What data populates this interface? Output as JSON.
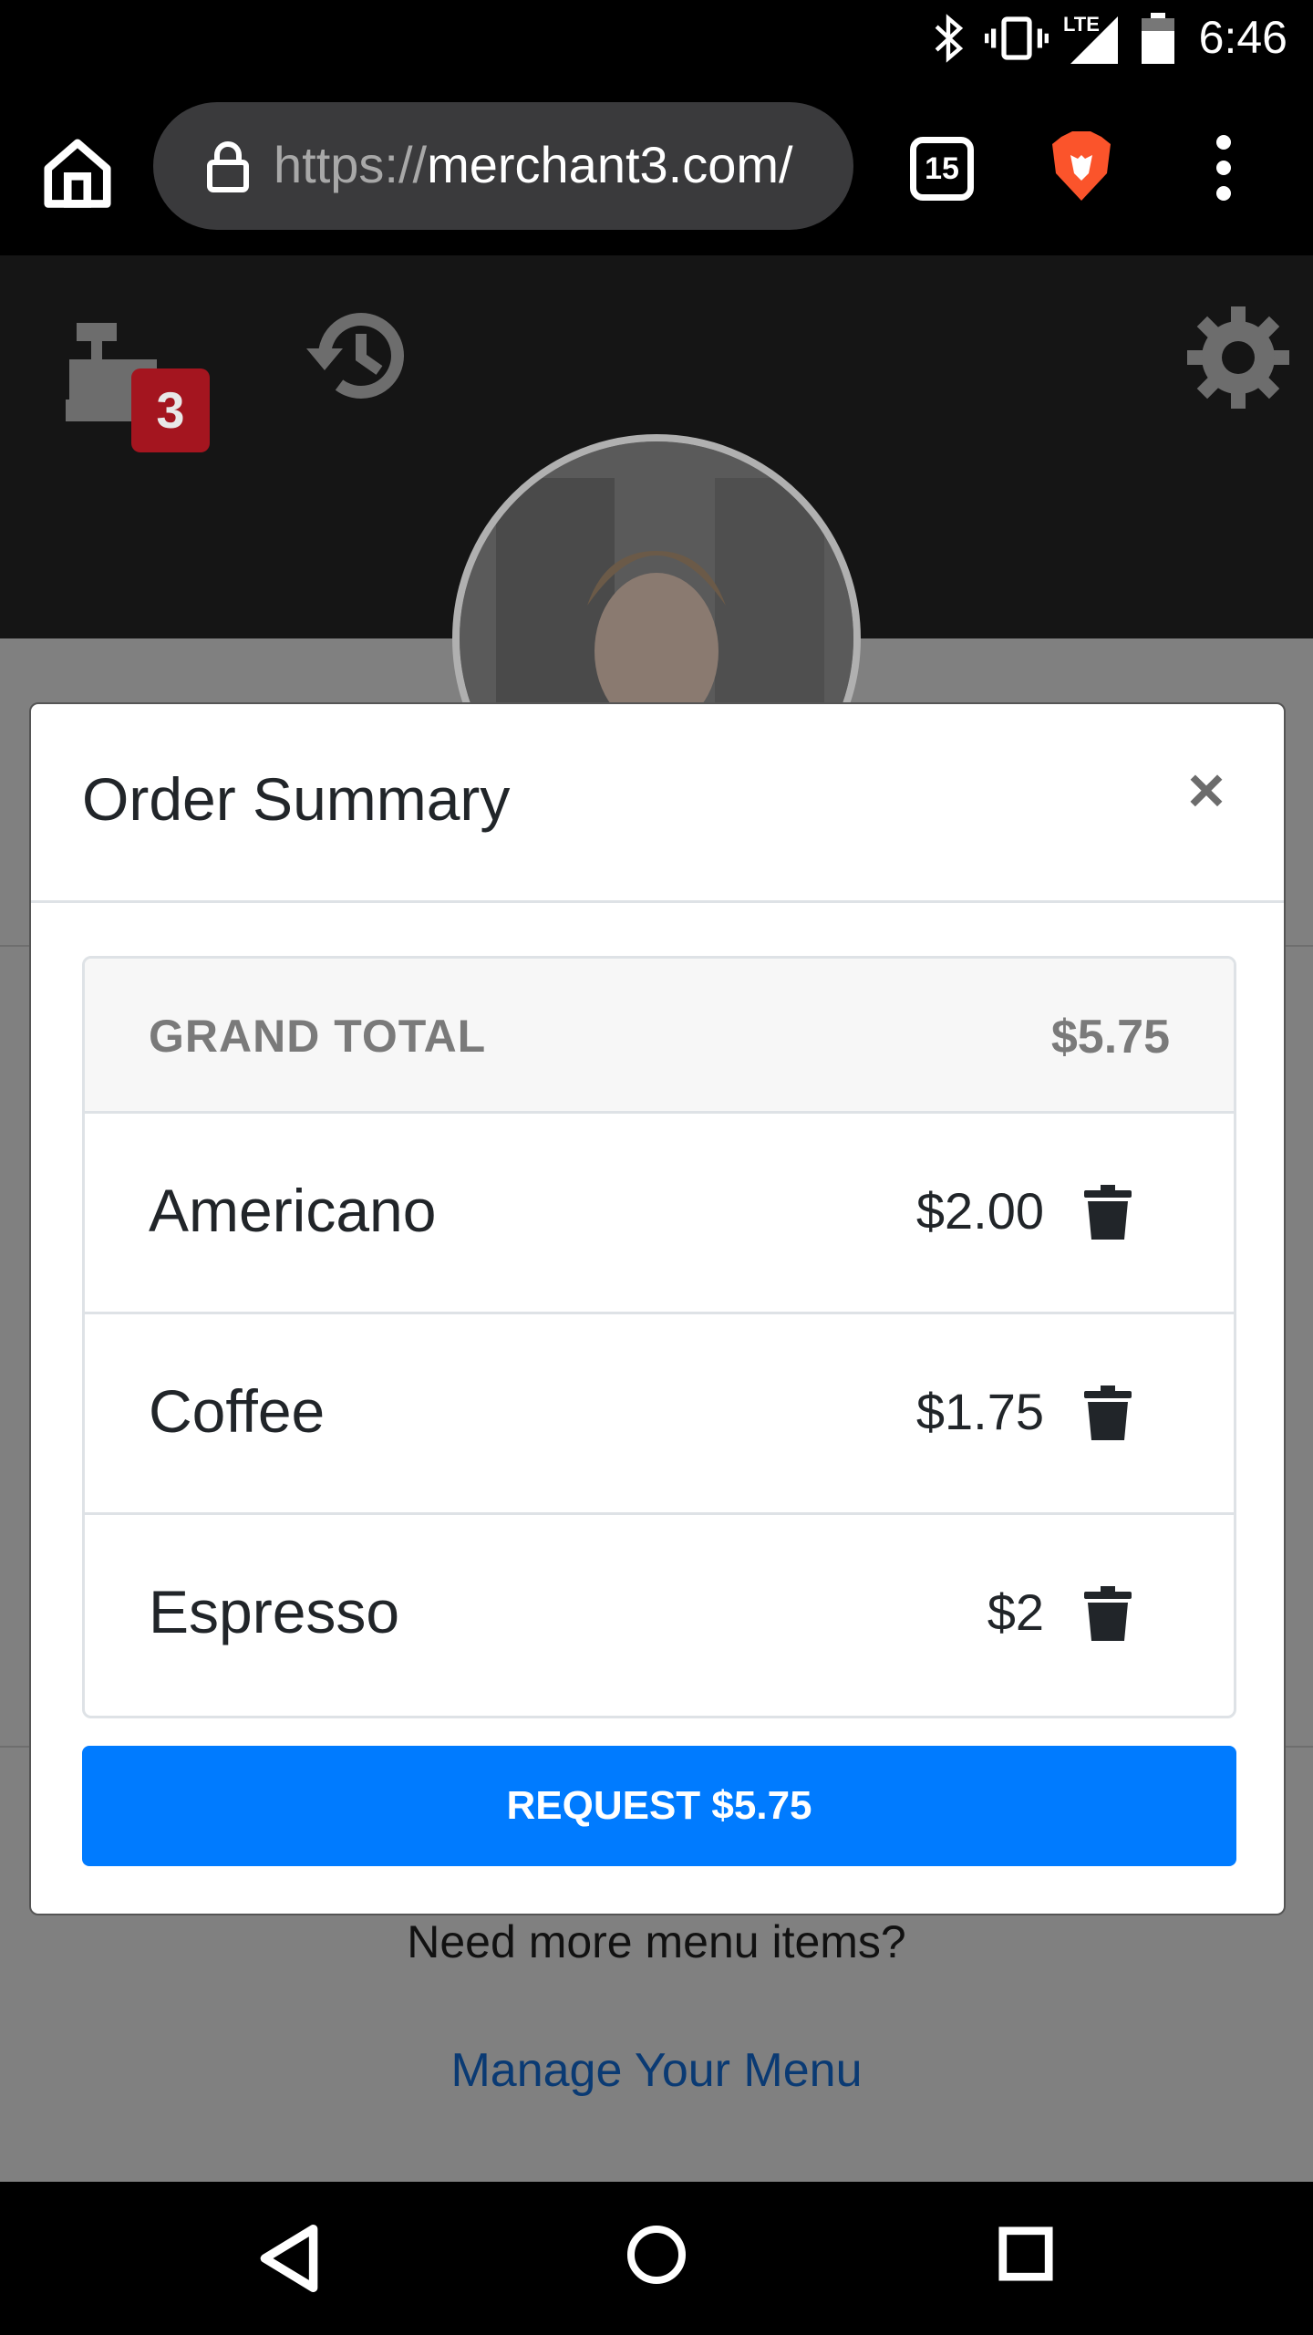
{
  "status_bar": {
    "time": "6:46",
    "icons": [
      "bluetooth-icon",
      "vibrate-icon",
      "lte-signal-icon",
      "battery-icon"
    ],
    "network_label": "LTE"
  },
  "browser": {
    "url_scheme": "https://",
    "url_host": "merchant3.com/",
    "tab_count": "15",
    "icons": [
      "home-icon",
      "lock-icon",
      "brave-lion-icon",
      "more-vert-icon"
    ]
  },
  "app_header": {
    "cart_badge_count": "3",
    "icons": [
      "cash-register-icon",
      "history-icon",
      "gear-icon"
    ]
  },
  "modal": {
    "title": "Order Summary",
    "close_label": "×",
    "grand_total_label": "GRAND TOTAL",
    "grand_total_value": "$5.75",
    "items": [
      {
        "name": "Americano",
        "price": "$2.00"
      },
      {
        "name": "Coffee",
        "price": "$1.75"
      },
      {
        "name": "Espresso",
        "price": "$2"
      }
    ],
    "request_button_label": "REQUEST $5.75"
  },
  "background_page": {
    "need_more_text": "Need more menu items?",
    "manage_menu_link": "Manage Your Menu"
  },
  "colors": {
    "primary": "#007bff",
    "badge": "#a4151f",
    "overlay": "#808080",
    "header_bg": "#151515"
  }
}
